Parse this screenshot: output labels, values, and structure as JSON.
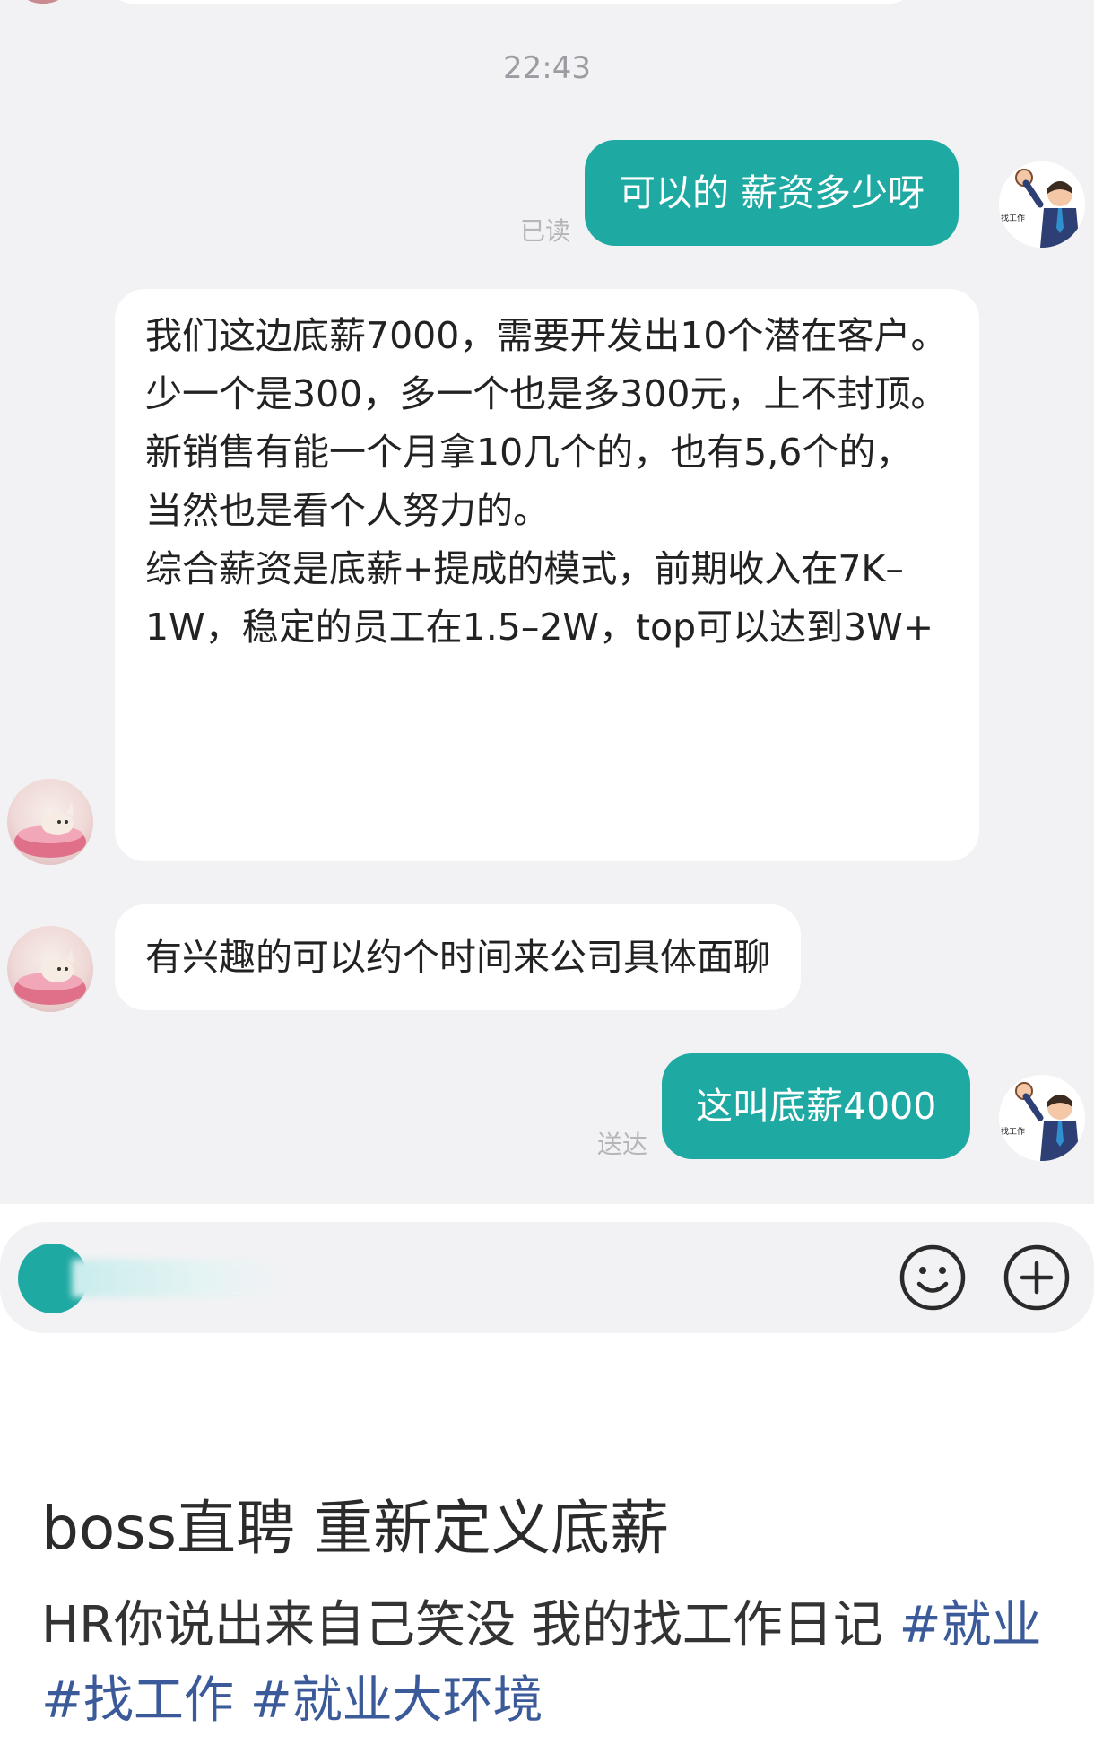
{
  "chat": {
    "timestamp": "22:43",
    "messages": [
      {
        "side": "out",
        "text": "可以的 薪资多少呀",
        "status": "已读"
      },
      {
        "side": "in",
        "lines": [
          "我们这边底薪7000，需要开发出10个潜在客户。",
          "少一个是300，多一个也是多300元，上不封顶。",
          "新销售有能一个月拿10几个的，也有5,6个的，当然也是看个人努力的。",
          "综合薪资是底薪+提成的模式，前期收入在7K–1W，稳定的员工在1.5–2W，top可以达到3W+"
        ]
      },
      {
        "side": "in",
        "text": "有兴趣的可以约个时间来公司具体面聊"
      },
      {
        "side": "out",
        "text": "这叫底薪4000",
        "status": "送达"
      }
    ],
    "my_avatar_caption": "找工作"
  },
  "input_bar": {
    "icons": [
      "voice-icon",
      "emoji-icon",
      "plus-icon"
    ]
  },
  "post": {
    "title": "boss直聘 重新定义底薪",
    "body_text": "HR你说出来自己笑没 我的找工作日记 ",
    "hashtags": [
      "#就业",
      "#找工作",
      "#就业大环境"
    ]
  },
  "colors": {
    "accent": "#1fa9a3",
    "chat_bg": "#f2f2f4",
    "hashtag": "#3b5a9a"
  }
}
